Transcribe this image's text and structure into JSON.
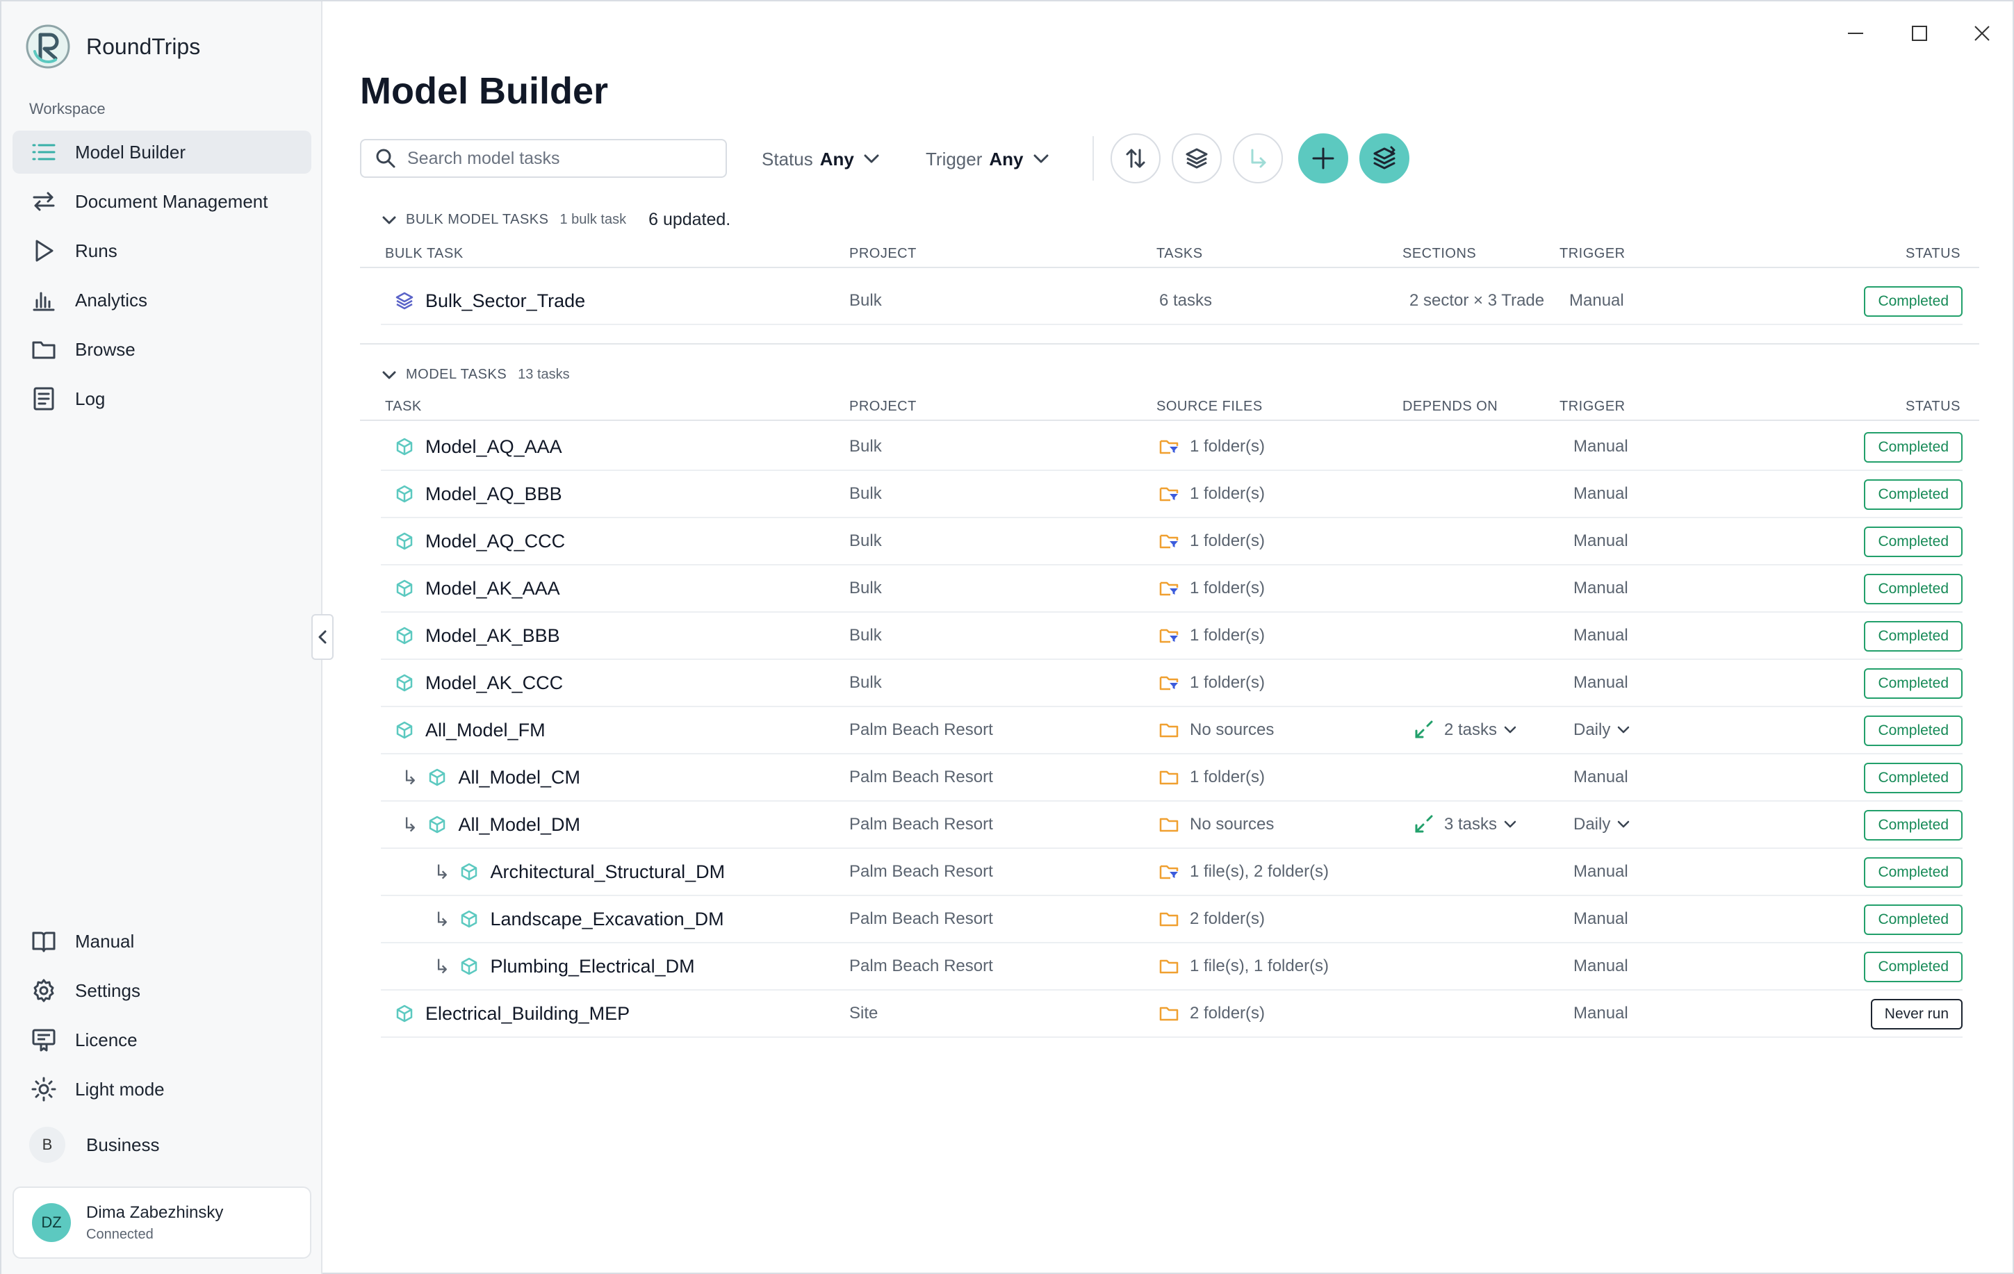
{
  "app": {
    "name": "RoundTrips"
  },
  "sidebar": {
    "workspace_label": "Workspace",
    "items": [
      {
        "label": "Model Builder",
        "icon": "list-icon"
      },
      {
        "label": "Document Management",
        "icon": "swap-arrows-icon"
      },
      {
        "label": "Runs",
        "icon": "play-icon"
      },
      {
        "label": "Analytics",
        "icon": "bar-chart-icon"
      },
      {
        "label": "Browse",
        "icon": "folder-icon"
      },
      {
        "label": "Log",
        "icon": "document-icon"
      }
    ],
    "bottom_items": [
      {
        "label": "Manual",
        "icon": "book-icon"
      },
      {
        "label": "Settings",
        "icon": "gear-icon"
      },
      {
        "label": "Licence",
        "icon": "certificate-icon"
      },
      {
        "label": "Light mode",
        "icon": "sun-icon"
      }
    ],
    "business": {
      "badge": "B",
      "label": "Business"
    },
    "user": {
      "initials": "DZ",
      "name": "Dima Zabezhinsky",
      "status": "Connected"
    }
  },
  "main": {
    "title": "Model Builder",
    "search_placeholder": "Search model tasks",
    "filters": {
      "status_label": "Status",
      "status_value": "Any",
      "trigger_label": "Trigger",
      "trigger_value": "Any"
    }
  },
  "bulk": {
    "title": "BULK MODEL TASKS",
    "count": "1 bulk task",
    "updated": "6 updated.",
    "columns": {
      "task": "BULK TASK",
      "project": "PROJECT",
      "tasks": "TASKS",
      "sections": "SECTIONS",
      "trigger": "TRIGGER",
      "status": "STATUS"
    },
    "rows": [
      {
        "name": "Bulk_Sector_Trade",
        "project": "Bulk",
        "tasks": "6 tasks",
        "sections": "2 sector × 3 Trade",
        "trigger": "Manual",
        "status": "Completed"
      }
    ]
  },
  "model": {
    "title": "MODEL TASKS",
    "count": "13 tasks",
    "columns": {
      "task": "TASK",
      "project": "PROJECT",
      "source": "SOURCE FILES",
      "depends": "DEPENDS ON",
      "trigger": "TRIGGER",
      "status": "STATUS"
    },
    "rows": [
      {
        "name": "Model_AQ_AAA",
        "level": 0,
        "project": "Bulk",
        "source": "1 folder(s)",
        "src_icon": "folder-filter-icon",
        "depends": "",
        "trigger": "Manual",
        "trigger_dd": false,
        "status": "Completed"
      },
      {
        "name": "Model_AQ_BBB",
        "level": 0,
        "project": "Bulk",
        "source": "1 folder(s)",
        "src_icon": "folder-filter-icon",
        "depends": "",
        "trigger": "Manual",
        "trigger_dd": false,
        "status": "Completed"
      },
      {
        "name": "Model_AQ_CCC",
        "level": 0,
        "project": "Bulk",
        "source": "1 folder(s)",
        "src_icon": "folder-filter-icon",
        "depends": "",
        "trigger": "Manual",
        "trigger_dd": false,
        "status": "Completed"
      },
      {
        "name": "Model_AK_AAA",
        "level": 0,
        "project": "Bulk",
        "source": "1 folder(s)",
        "src_icon": "folder-filter-icon",
        "depends": "",
        "trigger": "Manual",
        "trigger_dd": false,
        "status": "Completed"
      },
      {
        "name": "Model_AK_BBB",
        "level": 0,
        "project": "Bulk",
        "source": "1 folder(s)",
        "src_icon": "folder-filter-icon",
        "depends": "",
        "trigger": "Manual",
        "trigger_dd": false,
        "status": "Completed"
      },
      {
        "name": "Model_AK_CCC",
        "level": 0,
        "project": "Bulk",
        "source": "1 folder(s)",
        "src_icon": "folder-filter-icon",
        "depends": "",
        "trigger": "Manual",
        "trigger_dd": false,
        "status": "Completed"
      },
      {
        "name": "All_Model_FM",
        "level": 0,
        "project": "Palm Beach Resort",
        "source": "No sources",
        "src_icon": "folder-icon",
        "depends": "2 tasks",
        "trigger": "Daily",
        "trigger_dd": true,
        "status": "Completed"
      },
      {
        "name": "All_Model_CM",
        "level": 1,
        "project": "Palm Beach Resort",
        "source": "1 folder(s)",
        "src_icon": "folder-icon",
        "depends": "",
        "trigger": "Manual",
        "trigger_dd": false,
        "status": "Completed"
      },
      {
        "name": "All_Model_DM",
        "level": 1,
        "project": "Palm Beach Resort",
        "source": "No sources",
        "src_icon": "folder-icon",
        "depends": "3 tasks",
        "trigger": "Daily",
        "trigger_dd": true,
        "status": "Completed"
      },
      {
        "name": "Architectural_Structural_DM",
        "level": 2,
        "project": "Palm Beach Resort",
        "source": "1 file(s), 2 folder(s)",
        "src_icon": "folder-filter-icon",
        "depends": "",
        "trigger": "Manual",
        "trigger_dd": false,
        "status": "Completed"
      },
      {
        "name": "Landscape_Excavation_DM",
        "level": 2,
        "project": "Palm Beach Resort",
        "source": "2 folder(s)",
        "src_icon": "folder-icon",
        "depends": "",
        "trigger": "Manual",
        "trigger_dd": false,
        "status": "Completed"
      },
      {
        "name": "Plumbing_Electrical_DM",
        "level": 2,
        "project": "Palm Beach Resort",
        "source": "1 file(s), 1 folder(s)",
        "src_icon": "folder-icon",
        "depends": "",
        "trigger": "Manual",
        "trigger_dd": false,
        "status": "Completed"
      },
      {
        "name": "Electrical_Building_MEP",
        "level": 0,
        "project": "Site",
        "source": "2 folder(s)",
        "src_icon": "folder-icon",
        "depends": "",
        "trigger": "Manual",
        "trigger_dd": false,
        "status": "Never run"
      }
    ]
  },
  "colors": {
    "accent": "#5cc9c0",
    "completed": "#22a06b",
    "folder": "#f0a030",
    "dep_icon": "#22a06b"
  }
}
